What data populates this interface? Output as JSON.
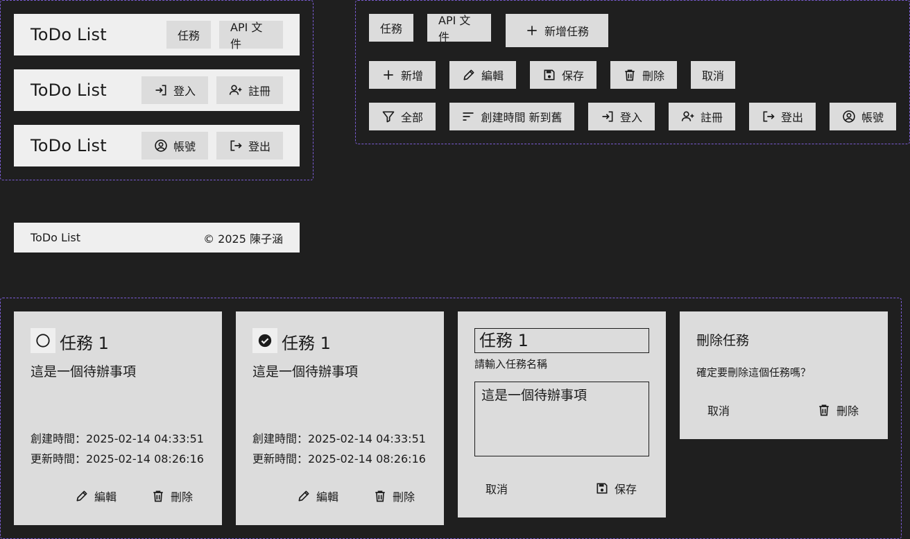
{
  "app_title": "ToDo List",
  "header_variants": [
    {
      "title": "ToDo List",
      "buttons": [
        {
          "label": "任務",
          "icon": ""
        },
        {
          "label": "API 文件",
          "icon": ""
        }
      ]
    },
    {
      "title": "ToDo List",
      "buttons": [
        {
          "label": "登入",
          "icon": "login-icon"
        },
        {
          "label": "註冊",
          "icon": "person-add-icon"
        }
      ]
    },
    {
      "title": "ToDo List",
      "buttons": [
        {
          "label": "帳號",
          "icon": "account-circle-icon"
        },
        {
          "label": "登出",
          "icon": "logout-icon"
        }
      ]
    }
  ],
  "buttons_showcase": {
    "row1": [
      {
        "label": "任務",
        "icon": ""
      },
      {
        "label": "API 文件",
        "icon": ""
      },
      {
        "label": "新增任務",
        "icon": "plus-icon"
      }
    ],
    "row2": [
      {
        "label": "新增",
        "icon": "plus-icon"
      },
      {
        "label": "編輯",
        "icon": "pencil-icon"
      },
      {
        "label": "保存",
        "icon": "save-icon"
      },
      {
        "label": "刪除",
        "icon": "trash-icon"
      },
      {
        "label": "取消",
        "icon": ""
      }
    ],
    "row3": [
      {
        "label": "全部",
        "icon": "filter-icon"
      },
      {
        "label": "創建時間 新到舊",
        "icon": "sort-icon"
      },
      {
        "label": "登入",
        "icon": "login-icon"
      },
      {
        "label": "註冊",
        "icon": "person-add-icon"
      },
      {
        "label": "登出",
        "icon": "logout-icon"
      },
      {
        "label": "帳號",
        "icon": "account-circle-icon"
      }
    ]
  },
  "footer": {
    "title": "ToDo List",
    "copyright": "© 2025 陳子涵"
  },
  "cards": {
    "todo_unchecked": {
      "title": "任務 1",
      "description": "這是一個待辦事項",
      "created": "創建時間：2025-02-14 04:33:51",
      "updated": "更新時間：2025-02-14 08:26:16",
      "edit_label": "編輯",
      "delete_label": "刪除",
      "completed": false
    },
    "todo_checked": {
      "title": "任務 1",
      "description": "這是一個待辦事項",
      "created": "創建時間：2025-02-14 04:33:51",
      "updated": "更新時間：2025-02-14 08:26:16",
      "edit_label": "編輯",
      "delete_label": "刪除",
      "completed": true
    },
    "edit_form": {
      "title_value": "任務 1",
      "title_hint": "請輸入任務名稱",
      "description_value": "這是一個待辦事項",
      "cancel_label": "取消",
      "save_label": "保存"
    },
    "delete_dialog": {
      "title": "刪除任務",
      "message": "確定要刪除這個任務嗎？",
      "cancel_label": "取消",
      "delete_label": "刪除"
    }
  },
  "colors": {
    "background": "#1f1f1f",
    "surface": "#efefef",
    "button": "#dcdcdc",
    "frame": "#7b5cd6",
    "text": "#1b1b1b"
  }
}
